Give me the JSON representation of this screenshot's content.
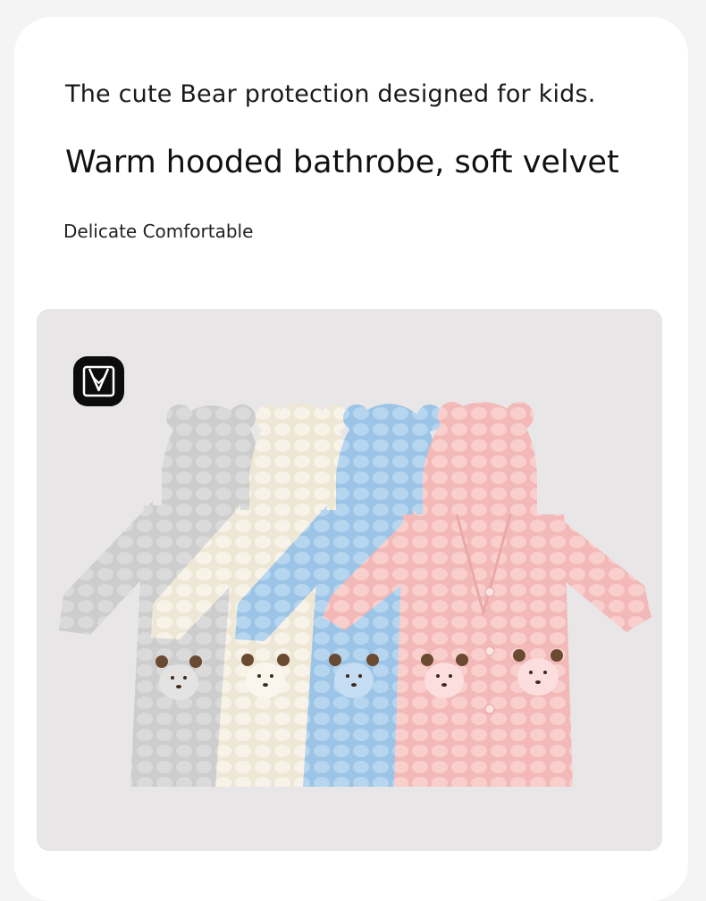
{
  "header": {
    "tagline": "The cute Bear protection designed for kids.",
    "headline": "Warm hooded bathrobe, soft velvet",
    "subtitle": "Delicate Comfortable"
  },
  "product_image": {
    "subject": "four hooded bear bathrobes",
    "colors": [
      "#cfcfcf",
      "#f5efe2",
      "#a9cdea",
      "#f5c3c3"
    ],
    "badge_icon": "robe-icon"
  }
}
